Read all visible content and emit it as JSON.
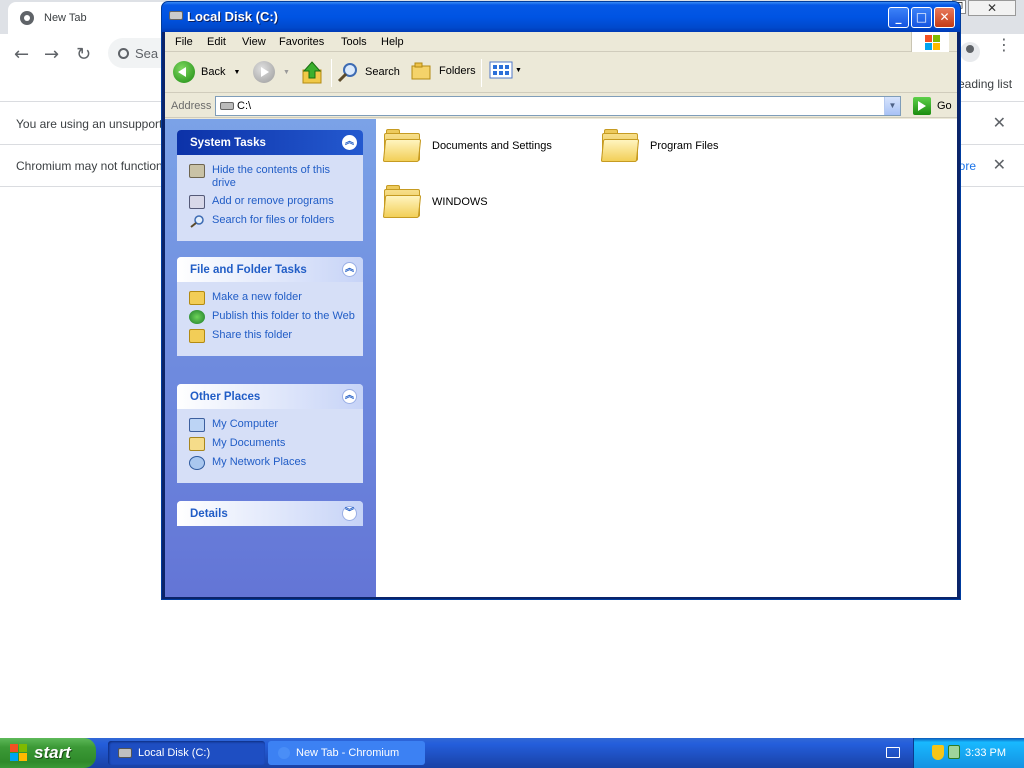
{
  "chromium": {
    "tab_title": "New Tab",
    "omnibox_partial": "Sea",
    "reading_list": "eading list",
    "info1": "You are using an unsupport",
    "info2": "Chromium may not function",
    "info2_link": "ore",
    "close_glyph": "✕"
  },
  "window": {
    "title": "Local Disk (C:)",
    "min": "_",
    "max": "□",
    "close": "✕"
  },
  "menu": [
    "File",
    "Edit",
    "View",
    "Favorites",
    "Tools",
    "Help"
  ],
  "toolbar": {
    "back": "Back",
    "search": "Search",
    "folders": "Folders"
  },
  "address": {
    "label": "Address",
    "value": "C:\\",
    "go": "Go"
  },
  "panels": {
    "system_tasks": {
      "title": "System Tasks",
      "items": [
        "Hide the contents of this drive",
        "Add or remove programs",
        "Search for files or folders"
      ]
    },
    "file_folder_tasks": {
      "title": "File and Folder Tasks",
      "items": [
        "Make a new folder",
        "Publish this folder to the Web",
        "Share this folder"
      ]
    },
    "other_places": {
      "title": "Other Places",
      "items": [
        "My Computer",
        "My Documents",
        "My Network Places"
      ]
    },
    "details": {
      "title": "Details"
    }
  },
  "files": [
    "Documents and Settings",
    "Program Files",
    "WINDOWS"
  ],
  "taskbar": {
    "start": "start",
    "buttons": [
      "Local Disk (C:)",
      "New Tab - Chromium"
    ],
    "clock": "3:33 PM"
  },
  "colors": {
    "titlebar": "#0054e3",
    "task_link": "#215dc6",
    "left_pane": "#6375d6",
    "start_green": "#3c9a37"
  }
}
